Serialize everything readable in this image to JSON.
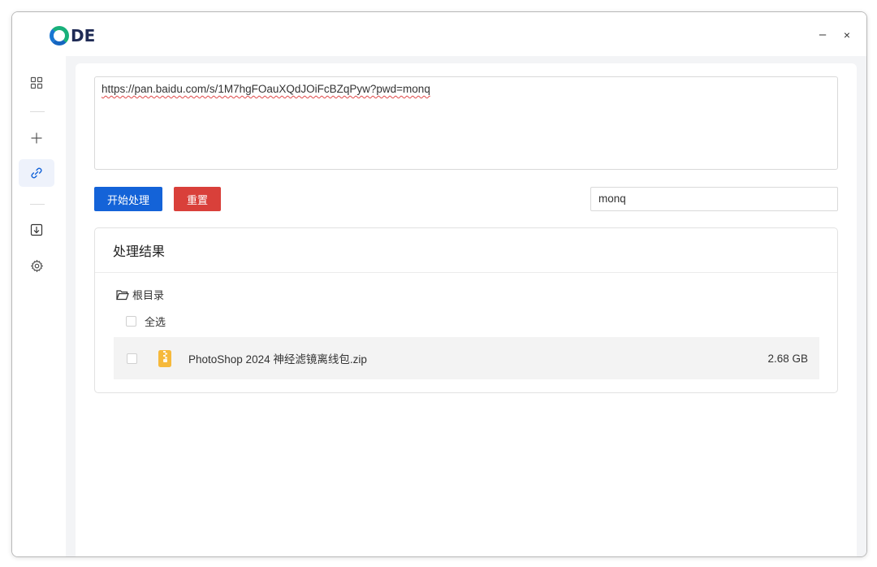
{
  "app": {
    "logo_text": "DE",
    "colors": {
      "accent": "#1463d8",
      "danger": "#d9403a",
      "logo_green": "#18b07a",
      "logo_blue": "#1976d2"
    }
  },
  "window_controls": {
    "minimize": "–",
    "close": "×"
  },
  "sidebar": {
    "items": [
      {
        "icon": "grid-icon",
        "active": false
      },
      {
        "icon": "plus-icon",
        "active": false
      },
      {
        "icon": "link-icon",
        "active": true
      },
      {
        "icon": "download-icon",
        "active": false
      },
      {
        "icon": "gear-icon",
        "active": false
      }
    ]
  },
  "main": {
    "url_value": "https://pan.baidu.com/s/1M7hgFOauXQdJOiFcBZqPyw?pwd=monq",
    "start_button": "开始处理",
    "reset_button": "重置",
    "password_value": "monq"
  },
  "results": {
    "title": "处理结果",
    "root_folder": "根目录",
    "select_all": "全选",
    "files": [
      {
        "name": "PhotoShop 2024 神经滤镜离线包.zip",
        "size": "2.68 GB",
        "icon": "zip-file-icon",
        "checked": false
      }
    ]
  }
}
